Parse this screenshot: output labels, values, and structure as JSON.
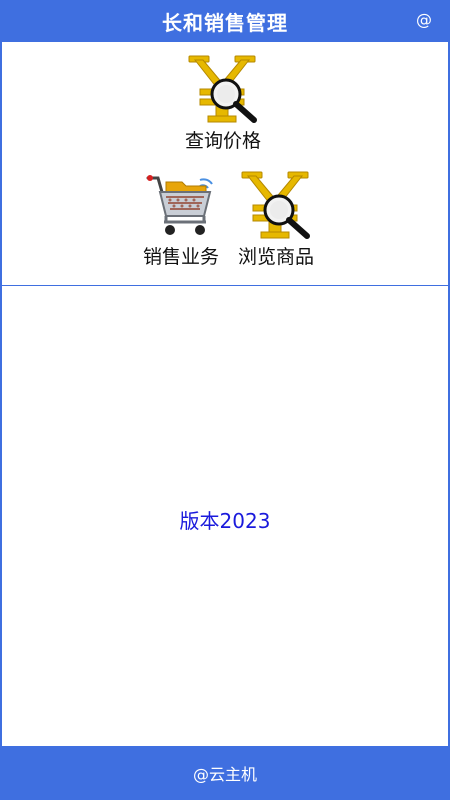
{
  "header": {
    "title": "长和销售管理",
    "right_icon_text": "@"
  },
  "menu": {
    "items": [
      {
        "label": "查询价格",
        "icon": "yen-magnifier-icon"
      },
      {
        "label": "销售业务",
        "icon": "shopping-cart-icon"
      },
      {
        "label": "浏览商品",
        "icon": "yen-magnifier-icon"
      }
    ]
  },
  "main": {
    "version_text": "版本2023"
  },
  "footer": {
    "text": "@云主机"
  },
  "colors": {
    "primary": "#3f6fe0",
    "version_text": "#1a1adc",
    "icon_gold": "#e6b800"
  }
}
